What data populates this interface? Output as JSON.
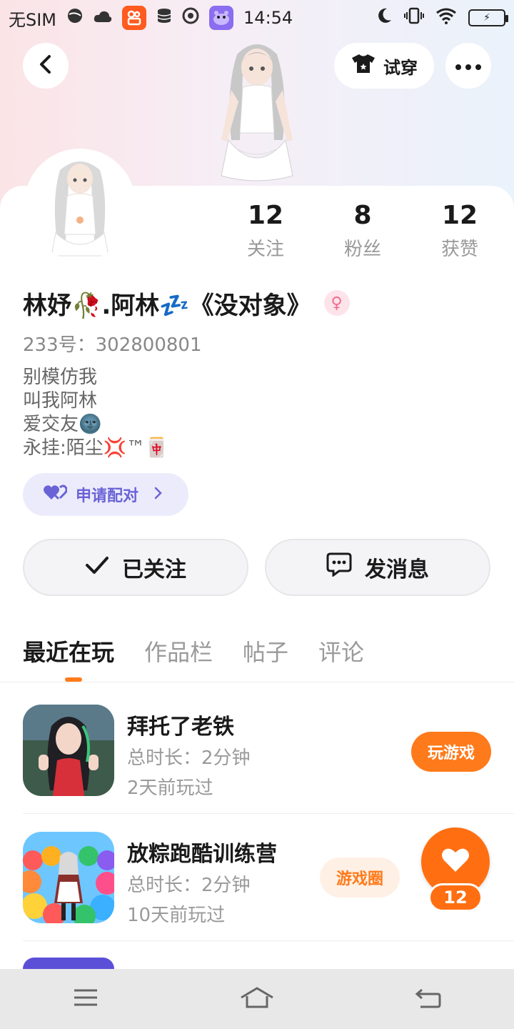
{
  "status_bar": {
    "carrier": "无SIM",
    "time": "14:54"
  },
  "header": {
    "try_on_label": "试穿"
  },
  "stats": [
    {
      "value": "12",
      "label": "关注"
    },
    {
      "value": "8",
      "label": "粉丝"
    },
    {
      "value": "12",
      "label": "获赞"
    }
  ],
  "profile": {
    "nickname": "林妤🥀.阿林💤《没对象》",
    "gender_symbol": "♀",
    "account_id": "233号：302800801",
    "bio_lines": [
      "别模仿我",
      "叫我阿林",
      "爱交友🌚",
      "永挂:陌尘💢™🀄"
    ]
  },
  "pair_button": {
    "label": "申请配对"
  },
  "actions": {
    "follow_label": "已关注",
    "message_label": "发消息"
  },
  "tabs": [
    {
      "label": "最近在玩",
      "active": true
    },
    {
      "label": "作品栏",
      "active": false
    },
    {
      "label": "帖子",
      "active": false
    },
    {
      "label": "评论",
      "active": false
    }
  ],
  "games": [
    {
      "name": "拜托了老铁",
      "duration": "总时长：2分钟",
      "last_played": "2天前玩过",
      "action_label": "玩游戏"
    },
    {
      "name": "放粽跑酷训练营",
      "duration": "总时长：2分钟",
      "last_played": "10天前玩过",
      "action_label": "游戏圈"
    }
  ],
  "like_fab": {
    "count": "12"
  },
  "colors": {
    "accent": "#ff7a1a",
    "pair_purple": "#6a63d6",
    "muted_text": "#9a9a9a"
  }
}
